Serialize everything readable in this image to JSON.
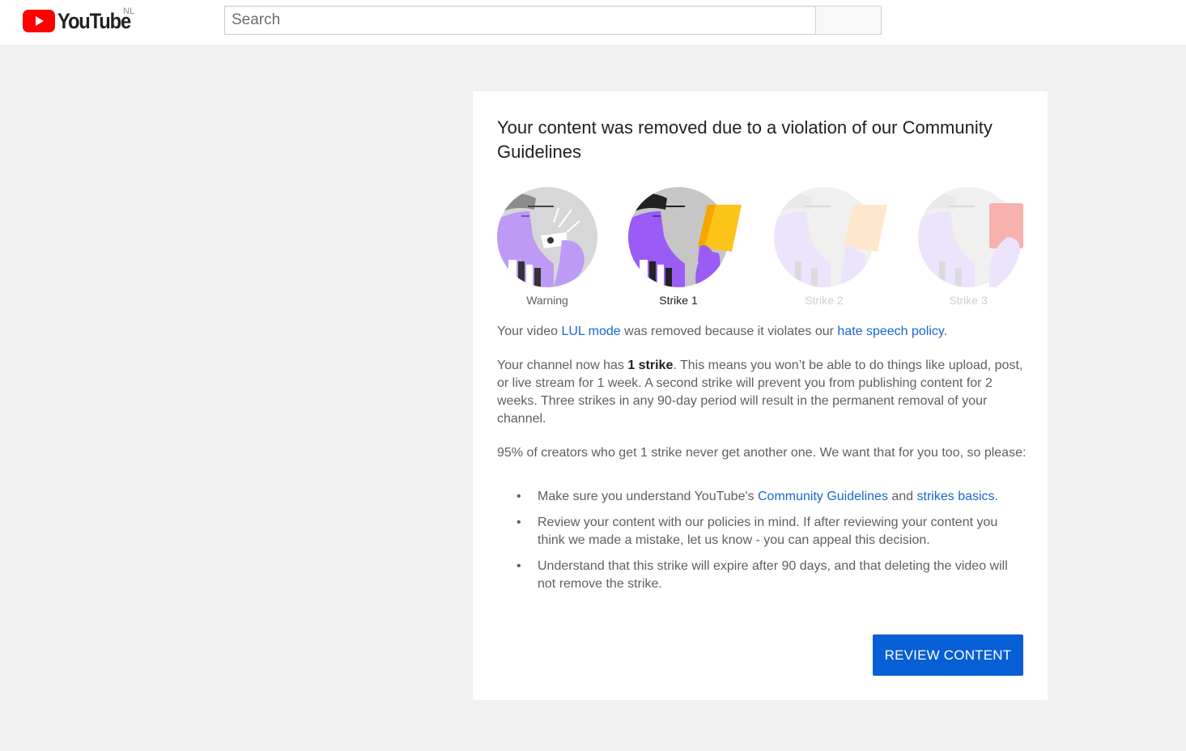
{
  "masthead": {
    "logo_text": "YouTube",
    "country_code": "NL",
    "search_placeholder": "Search"
  },
  "notice": {
    "title": "Your content was removed due to a violation of our Community Guidelines",
    "strikes": [
      {
        "label": "Warning",
        "state": "past",
        "label_color": "#606060"
      },
      {
        "label": "Strike 1",
        "state": "current",
        "label_color": "#212121"
      },
      {
        "label": "Strike 2",
        "state": "future",
        "label_color": "#d0d0d0"
      },
      {
        "label": "Strike 3",
        "state": "future",
        "label_color": "#d0d0d0"
      }
    ],
    "video_para": {
      "prefix": "Your video ",
      "video_link": "LUL mode",
      "middle": " was removed because it violates our ",
      "policy_link": "hate speech policy",
      "suffix": "."
    },
    "channel_para": {
      "prefix": "Your channel now has ",
      "strike_count": "1 strike",
      "suffix": ". This means you won’t be able to do things like upload, post, or live stream for 1 week. A second strike will prevent you from publishing content for 2 weeks. Three strikes in any 90-day period will result in the permanent removal of your channel."
    },
    "creators_para": "95% of creators who get 1 strike never get another one. We want that for you too, so please:",
    "bullets": {
      "b1_prefix": "Make sure you understand YouTube's ",
      "b1_link1": "Community Guidelines",
      "b1_middle": " and ",
      "b1_link2": "strikes basics.",
      "b2": "Review your content with our policies in mind. If after reviewing your content you think we made a mistake, let us know - you can appeal this decision.",
      "b3": "Understand that this strike will expire after 90 days, and that deleting the video will not remove the strike."
    },
    "review_button": "REVIEW CONTENT"
  },
  "colors": {
    "accent_button": "#065fd4",
    "link": "#1967d2",
    "youtube_red": "#ff0000",
    "card_yellow": "#fcc419",
    "card_red": "#ef5350",
    "purple": "#9a5cf5"
  },
  "icons": [
    "youtube-play-icon",
    "whistle-referee-icon",
    "yellow-card-referee-icon",
    "orange-card-referee-icon",
    "red-card-referee-icon"
  ]
}
